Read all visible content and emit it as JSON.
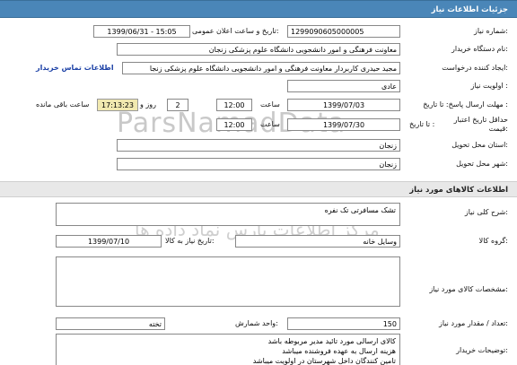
{
  "header": {
    "title": "جزئیات اطلاعات نیاز"
  },
  "need_number": {
    "label": "شماره نیاز:",
    "value": "1299090605000005"
  },
  "announce": {
    "label": "تاریخ و ساعت اعلان عمومی:",
    "value": "1399/06/31 - 15:05"
  },
  "buyer_org": {
    "label": "نام دستگاه خریدار:",
    "value": "معاونت فرهنگی و امور دانشجویی دانشگاه علوم پزشکی زنجان"
  },
  "creator": {
    "label": "ایجاد کننده درخواست:",
    "value": "مجید حیدری کاربردار معاونت فرهنگی و امور دانشجویی دانشگاه علوم پزشکی زنجا",
    "contact_link": "اطلاعات تماس خریدار"
  },
  "priority": {
    "label": "اولویت نیاز :",
    "value": "عادی"
  },
  "response_deadline": {
    "label": "مهلت ارسال پاسخ: تا تاریخ :",
    "date": "1399/07/03",
    "time_label": "ساعت",
    "time": "12:00",
    "days": "2",
    "days_label": "روز و",
    "remaining_time": "17:13:23",
    "remaining_label": "ساعت باقی مانده"
  },
  "price_validity": {
    "label_line1": "حداقل تاریخ اعتبار",
    "label_line2": "قیمت:",
    "date_label": "تا تاریخ :",
    "date": "1399/07/30",
    "time_label": "ساعت",
    "time": "12:00"
  },
  "delivery_province": {
    "label": "استان محل تحویل:",
    "value": "زنجان"
  },
  "delivery_city": {
    "label": "شهر محل تحویل:",
    "value": "زنجان"
  },
  "goods_header": {
    "title": "اطلاعات کالاهای مورد نیاز"
  },
  "general_desc": {
    "label": "شرح کلی نیاز:",
    "value": "تشک مسافرتی تک نفره"
  },
  "goods_group": {
    "label": "گروه کالا:",
    "value": "وسایل خانه",
    "need_date_label": "تاریخ نیاز به کالا:",
    "need_date": "1399/07/10"
  },
  "goods_specs": {
    "label": "مشخصات کالای مورد نیاز:",
    "value": ""
  },
  "quantity": {
    "label": "تعداد / مقدار مورد نیاز:",
    "value": "150",
    "unit_label": "واحد شمارش:",
    "unit": "تخته"
  },
  "buyer_notes": {
    "label": "توضیحات خریدار:",
    "lines": [
      "کالای ارسالی مورد تائید مدیر مربوطه باشد",
      "هزینه ارسال به عهده فروشنده میباشد",
      "تامین کنندگان داخل شهرستان در اولویت میباشد"
    ]
  },
  "watermark": {
    "brand": "ParsNamadData",
    "slogan": "پارس نماد داده ها",
    "slogan2": "مرکز اطلاعات پارس نماد داده ها",
    "phone": "021-88349670-5"
  }
}
